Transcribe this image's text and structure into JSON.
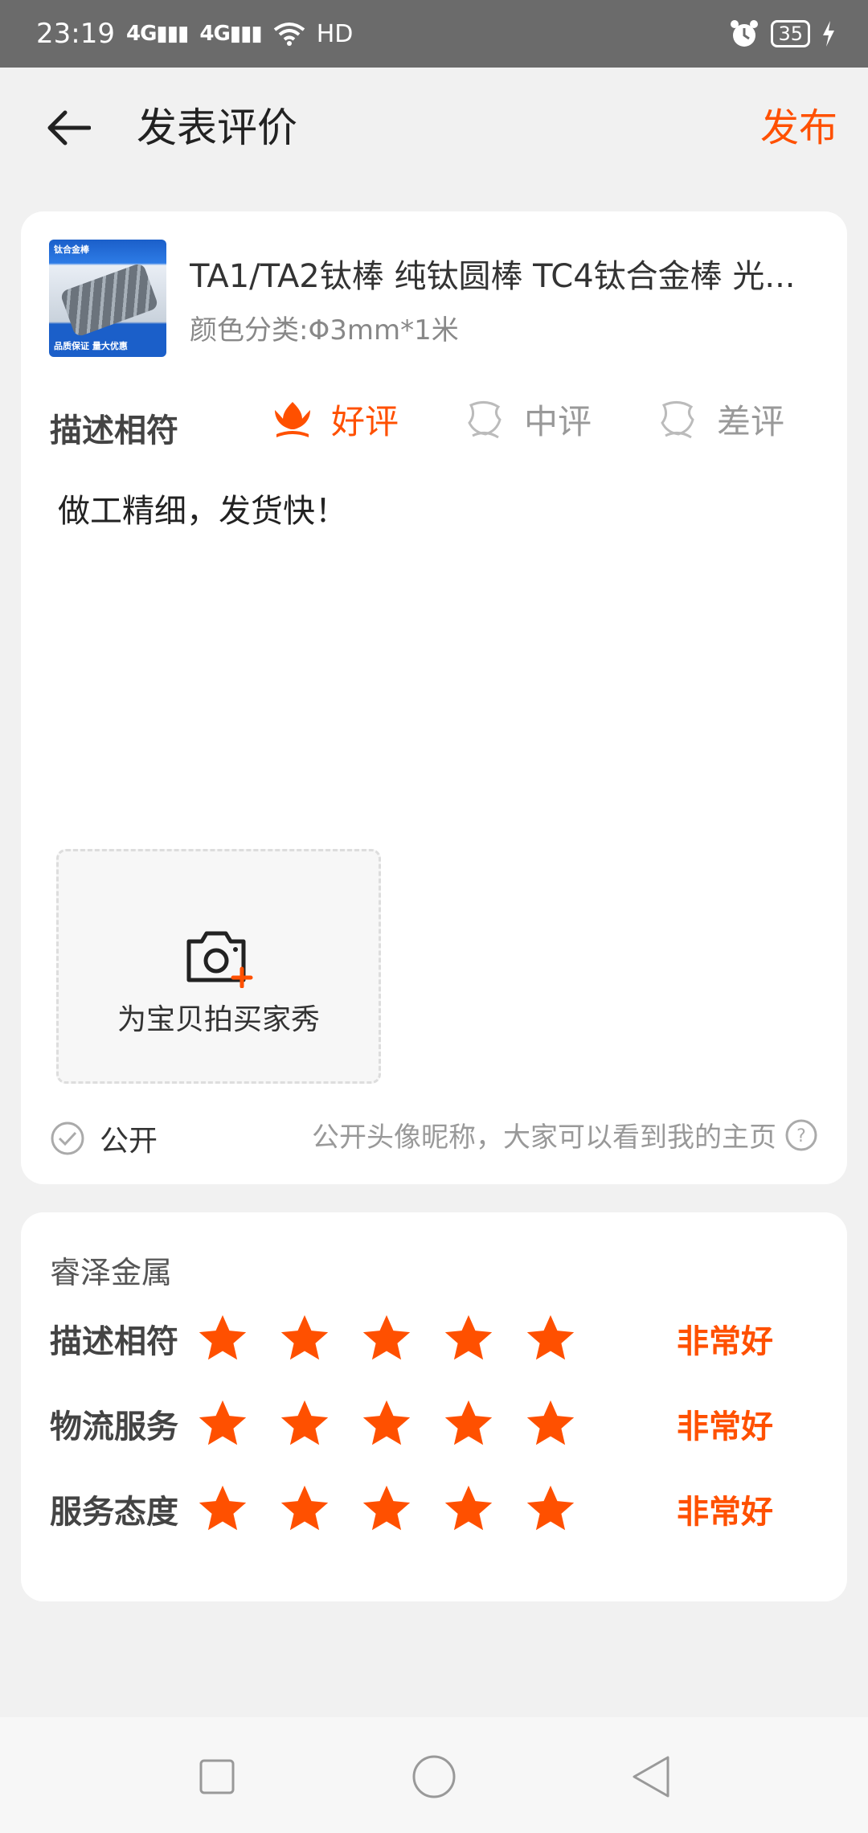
{
  "status_bar": {
    "time": "23:19",
    "signal1": "4G",
    "signal2": "4G",
    "hd": "HD",
    "battery": "35",
    "icons": [
      "signal-icon",
      "wifi-icon",
      "alarm-icon",
      "battery-icon",
      "charging-icon"
    ]
  },
  "header": {
    "title": "发表评价",
    "publish_label": "发布",
    "back_icon": "arrow-left-icon"
  },
  "product": {
    "title": "TA1/TA2钛棒 纯钛圆棒 TC4钛合金棒 光...",
    "spec": "颜色分类:Φ3mm*1米",
    "image_text_top": "钛合金棒",
    "image_text_bottom": "品质保证 量大优惠"
  },
  "rating": {
    "label": "描述相符",
    "options": [
      {
        "label": "好评",
        "selected": true
      },
      {
        "label": "中评",
        "selected": false
      },
      {
        "label": "差评",
        "selected": false
      }
    ]
  },
  "review_text": "做工精细，发货快！",
  "photo": {
    "label": "为宝贝拍买家秀"
  },
  "public": {
    "label": "公开",
    "hint": "公开头像昵称，大家可以看到我的主页",
    "checked": true
  },
  "shop": {
    "name": "睿泽金属",
    "scores": [
      {
        "label": "描述相符",
        "stars": 5,
        "text": "非常好"
      },
      {
        "label": "物流服务",
        "stars": 5,
        "text": "非常好"
      },
      {
        "label": "服务态度",
        "stars": 5,
        "text": "非常好"
      }
    ]
  },
  "colors": {
    "accent": "#ff5000",
    "background": "#f1f1f1",
    "card": "#ffffff"
  }
}
